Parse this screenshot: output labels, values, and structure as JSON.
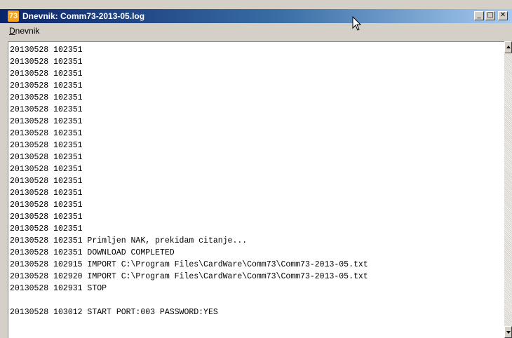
{
  "window": {
    "title": "Dnevnik: Comm73-2013-05.log",
    "app_icon_text": "73",
    "buttons": {
      "minimize": "_",
      "maximize": "□",
      "close": "✕"
    }
  },
  "menu": {
    "items": [
      {
        "label": "Dnevnik",
        "accelerator": "D"
      }
    ]
  },
  "log": {
    "lines": [
      "20130528 102351",
      "20130528 102351",
      "20130528 102351",
      "20130528 102351",
      "20130528 102351",
      "20130528 102351",
      "20130528 102351",
      "20130528 102351",
      "20130528 102351",
      "20130528 102351",
      "20130528 102351",
      "20130528 102351",
      "20130528 102351",
      "20130528 102351",
      "20130528 102351",
      "20130528 102351",
      "20130528 102351 Primljen NAK, prekidam citanje...",
      "20130528 102351 DOWNLOAD COMPLETED",
      "20130528 102915 IMPORT C:\\Program Files\\CardWare\\Comm73\\Comm73-2013-05.txt",
      "20130528 102920 IMPORT C:\\Program Files\\CardWare\\Comm73\\Comm73-2013-05.txt",
      "20130528 102931 STOP",
      "",
      "20130528 103012 START PORT:003 PASSWORD:YES"
    ]
  },
  "icons": {
    "app": "app-icon",
    "cursor": "mouse-pointer-icon",
    "scroll_up": "arrow-up-icon",
    "scroll_down": "arrow-down-icon"
  }
}
